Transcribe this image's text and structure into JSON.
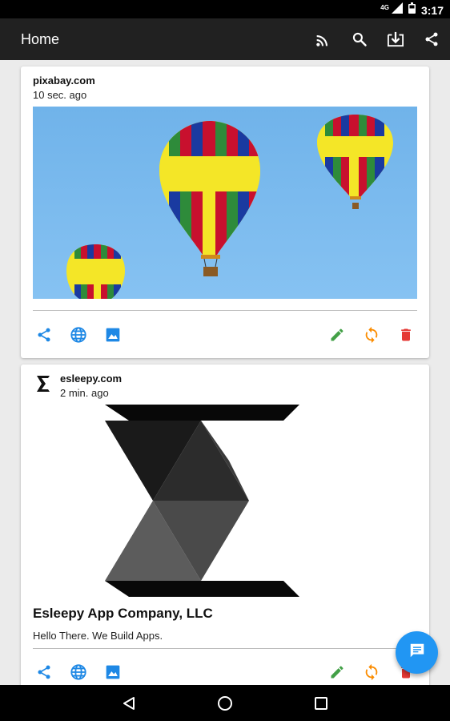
{
  "status_bar": {
    "network": "4G",
    "time": "3:17"
  },
  "app_bar": {
    "title": "Home",
    "actions": [
      "cast-icon",
      "search-icon",
      "download-icon",
      "share-icon"
    ]
  },
  "posts": [
    {
      "source": "pixabay.com",
      "time": "10 sec. ago",
      "image": "hot-air-balloons-photo",
      "actions_left": [
        "share-icon",
        "globe-icon",
        "image-icon"
      ],
      "actions_right": [
        "edit-icon",
        "refresh-icon",
        "delete-icon"
      ]
    },
    {
      "source": "esleepy.com",
      "time": "2 min. ago",
      "image": "esleepy-logo",
      "title": "Esleepy App Company, LLC",
      "description": "Hello There. We Build Apps.",
      "actions_left": [
        "share-icon",
        "globe-icon",
        "image-icon"
      ],
      "actions_right": [
        "edit-icon",
        "refresh-icon",
        "delete-icon"
      ]
    }
  ],
  "fab": {
    "icon": "message-icon"
  },
  "colors": {
    "app_bar": "#212121",
    "accent_blue": "#1e88e5",
    "edit_green": "#43a047",
    "refresh_orange": "#fb8c00",
    "delete_red": "#e53935",
    "fab": "#2196f3"
  }
}
